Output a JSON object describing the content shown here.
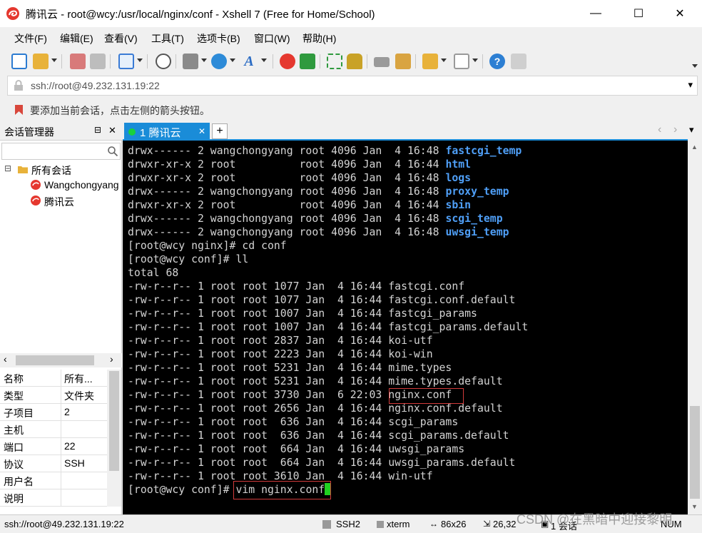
{
  "window": {
    "title": "腾讯云 - root@wcy:/usr/local/nginx/conf - Xshell 7 (Free for Home/School)",
    "minimize": "—",
    "maximize": "☐",
    "close": "✕"
  },
  "menu": [
    "文件(F)",
    "编辑(E)",
    "查看(V)",
    "工具(T)",
    "选项卡(B)",
    "窗口(W)",
    "帮助(H)"
  ],
  "address": {
    "value": "ssh://root@49.232.131.19:22",
    "dropdown": "▾"
  },
  "hint": "要添加当前会话，点击左侧的箭头按钮。",
  "session_manager": {
    "title": "会话管理器",
    "pin": "⊟",
    "close": "✕",
    "tree": {
      "root_toggle": "⊟",
      "root": "所有会话",
      "children": [
        "Wangchongyang",
        "腾讯云"
      ]
    },
    "scroll_left": "‹",
    "scroll_right": "›",
    "properties": [
      {
        "key": "名称",
        "value": "所有..."
      },
      {
        "key": "类型",
        "value": "文件夹"
      },
      {
        "key": "子项目",
        "value": "2"
      },
      {
        "key": "主机",
        "value": ""
      },
      {
        "key": "端口",
        "value": "22"
      },
      {
        "key": "协议",
        "value": "SSH"
      },
      {
        "key": "用户名",
        "value": ""
      },
      {
        "key": "说明",
        "value": ""
      }
    ]
  },
  "tabs": {
    "active": {
      "label": "1 腾讯云",
      "close": "✕"
    },
    "add": "+",
    "nav_prev": "‹",
    "nav_next": "›",
    "menu": "▾"
  },
  "terminal": {
    "dir_lines": [
      {
        "prefix": "drwx------ 2 wangchongyang root 4096 Jan  4 16:48 ",
        "name": "fastcgi_temp"
      },
      {
        "prefix": "drwxr-xr-x 2 root          root 4096 Jan  4 16:44 ",
        "name": "html"
      },
      {
        "prefix": "drwxr-xr-x 2 root          root 4096 Jan  4 16:48 ",
        "name": "logs"
      },
      {
        "prefix": "drwx------ 2 wangchongyang root 4096 Jan  4 16:48 ",
        "name": "proxy_temp"
      },
      {
        "prefix": "drwxr-xr-x 2 root          root 4096 Jan  4 16:44 ",
        "name": "sbin"
      },
      {
        "prefix": "drwx------ 2 wangchongyang root 4096 Jan  4 16:48 ",
        "name": "scgi_temp"
      },
      {
        "prefix": "drwx------ 2 wangchongyang root 4096 Jan  4 16:48 ",
        "name": "uwsgi_temp"
      }
    ],
    "cmd_cd": "[root@wcy nginx]# cd conf",
    "cmd_ll": "[root@wcy conf]# ll",
    "total": "total 68",
    "file_lines": [
      "-rw-r--r-- 1 root root 1077 Jan  4 16:44 fastcgi.conf",
      "-rw-r--r-- 1 root root 1077 Jan  4 16:44 fastcgi.conf.default",
      "-rw-r--r-- 1 root root 1007 Jan  4 16:44 fastcgi_params",
      "-rw-r--r-- 1 root root 1007 Jan  4 16:44 fastcgi_params.default",
      "-rw-r--r-- 1 root root 2837 Jan  4 16:44 koi-utf",
      "-rw-r--r-- 1 root root 2223 Jan  4 16:44 koi-win",
      "-rw-r--r-- 1 root root 5231 Jan  4 16:44 mime.types",
      "-rw-r--r-- 1 root root 5231 Jan  4 16:44 mime.types.default",
      "-rw-r--r-- 1 root root 3730 Jan  6 22:03 nginx.conf",
      "-rw-r--r-- 1 root root 2656 Jan  4 16:44 nginx.conf.default",
      "-rw-r--r-- 1 root root  636 Jan  4 16:44 scgi_params",
      "-rw-r--r-- 1 root root  636 Jan  4 16:44 scgi_params.default",
      "-rw-r--r-- 1 root root  664 Jan  4 16:44 uwsgi_params",
      "-rw-r--r-- 1 root root  664 Jan  4 16:44 uwsgi_params.default",
      "-rw-r--r-- 1 root root 3610 Jan  4 16:44 win-utf"
    ],
    "prompt": "[root@wcy conf]# ",
    "command": "vim nginx.conf"
  },
  "status": {
    "connection": "ssh://root@49.232.131.19:22",
    "protocol": "SSH2",
    "term": "xterm",
    "size": "86x26",
    "cursor": "26,32",
    "sessions": "1 会话",
    "numlock": "NUM",
    "watermark": "CSDN @在黑暗中迎接黎明"
  },
  "colors": {
    "accent": "#1a8cd8",
    "dir": "#4f9ff7",
    "highlight_box": "#d23b3b",
    "cursor": "#20d020"
  }
}
